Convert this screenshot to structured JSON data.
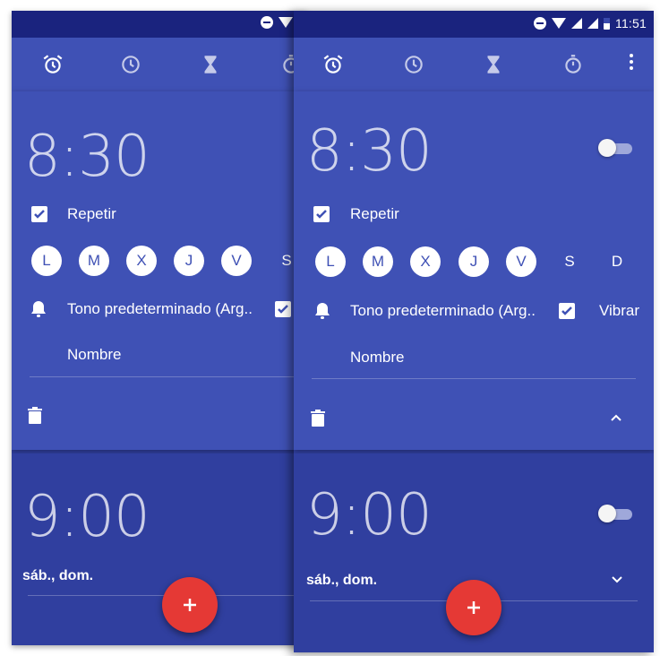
{
  "status_bar": {
    "time": "11:51"
  },
  "tabs": [
    {
      "name": "alarm-tab",
      "icon": "alarm-clock-icon"
    },
    {
      "name": "clock-tab",
      "icon": "clock-icon"
    },
    {
      "name": "timer-tab",
      "icon": "hourglass-icon"
    },
    {
      "name": "stopwatch-tab",
      "icon": "stopwatch-icon"
    }
  ],
  "alarm1": {
    "time": "8:30",
    "repeat_label": "Repetir",
    "repeat_checked": true,
    "days": [
      "L",
      "M",
      "X",
      "J",
      "V",
      "S",
      "D"
    ],
    "days_selected": [
      true,
      true,
      true,
      true,
      true,
      false,
      false
    ],
    "ringtone": "Tono predeterminado (Arg..",
    "vibrate_label": "Vibrar",
    "vibrate_checked": true,
    "name_placeholder": "Nombre",
    "enabled": false
  },
  "alarm2": {
    "time": "9:00",
    "schedule": "sáb., dom.",
    "enabled": false
  },
  "fab": {
    "icon": "plus-icon"
  },
  "colors": {
    "primary": "#3f51b5",
    "primary_dark": "#303f9f",
    "status_bar": "#1a237e",
    "accent": "#e53935"
  }
}
